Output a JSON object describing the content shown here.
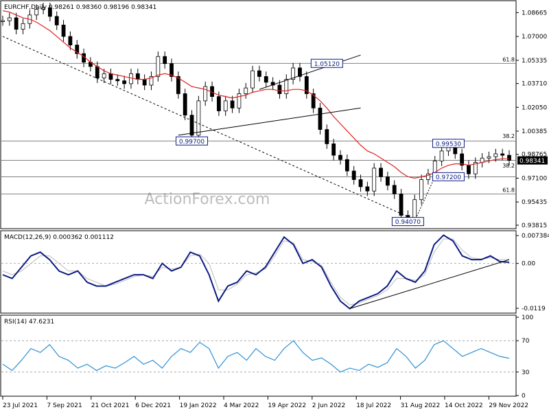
{
  "header": {
    "title": "EURCHF,Daily",
    "ohlc": "0.98261 0.98360 0.98196 0.98341"
  },
  "watermark": "ActionForex.com",
  "colors": {
    "candle": "#000000",
    "sma": "#e02020",
    "macd": "#0a1a80",
    "signal": "#bbbbbb",
    "rsi": "#2c8fd6",
    "levelBox": "#0a1a80"
  },
  "chart_data": [
    {
      "type": "candlestick",
      "title": "EURCHF,Daily",
      "ohlc_last": {
        "open": 0.98261,
        "high": 0.9836,
        "low": 0.98196,
        "close": 0.98341
      },
      "ylim": [
        0.9362,
        1.0945
      ],
      "y_ticks": [
        "1.08665",
        "1.07000",
        "1.05335",
        "1.03710",
        "1.02050",
        "1.00385",
        "0.98765",
        "0.97100",
        "0.95435",
        "0.93815"
      ],
      "y_tick_values": [
        1.08665,
        1.07,
        1.05335,
        1.0371,
        1.0205,
        1.00385,
        0.98765,
        0.971,
        0.95435,
        0.93815
      ],
      "current_price": "0.98341",
      "dates": [
        "23 Jul 2021",
        "7 Sep 2021",
        "21 Oct 2021",
        "6 Dec 2021",
        "19 Jan 2022",
        "4 Mar 2022",
        "19 Apr 2022",
        "2 Jun 2022",
        "18 Jul 2022",
        "31 Aug 2022",
        "14 Oct 2022",
        "29 Nov 2022"
      ],
      "close_series": [
        1.081,
        1.083,
        1.075,
        1.079,
        1.085,
        1.089,
        1.09,
        1.084,
        1.078,
        1.07,
        1.064,
        1.058,
        1.052,
        1.049,
        1.041,
        1.044,
        1.04,
        1.039,
        1.037,
        1.044,
        1.04,
        1.036,
        1.042,
        1.056,
        1.051,
        1.042,
        1.03,
        1.015,
        1.001,
        1.025,
        1.035,
        1.028,
        1.018,
        1.025,
        1.02,
        1.03,
        1.034,
        1.046,
        1.042,
        1.038,
        1.036,
        1.03,
        1.04,
        1.048,
        1.042,
        1.03,
        1.02,
        1.005,
        0.995,
        0.987,
        0.984,
        0.976,
        0.97,
        0.965,
        0.962,
        0.978,
        0.972,
        0.966,
        0.96,
        0.945,
        0.941,
        0.956,
        0.97,
        0.974,
        0.983,
        0.99,
        0.995,
        0.988,
        0.98,
        0.974,
        0.982,
        0.985,
        0.986,
        0.988,
        0.987,
        0.9834
      ],
      "sma_series": [
        1.088,
        1.087,
        1.085,
        1.083,
        1.082,
        1.08,
        1.077,
        1.074,
        1.07,
        1.066,
        1.062,
        1.059,
        1.056,
        1.052,
        1.049,
        1.046,
        1.044,
        1.043,
        1.042,
        1.041,
        1.04,
        1.04,
        1.041,
        1.043,
        1.044,
        1.043,
        1.041,
        1.038,
        1.035,
        1.034,
        1.033,
        1.031,
        1.029,
        1.028,
        1.027,
        1.028,
        1.029,
        1.031,
        1.032,
        1.033,
        1.033,
        1.032,
        1.032,
        1.033,
        1.033,
        1.032,
        1.029,
        1.025,
        1.02,
        1.014,
        1.009,
        1.004,
        0.999,
        0.994,
        0.99,
        0.988,
        0.985,
        0.982,
        0.979,
        0.975,
        0.972,
        0.971,
        0.972,
        0.973,
        0.975,
        0.978,
        0.98,
        0.981,
        0.981,
        0.98,
        0.981,
        0.982,
        0.983,
        0.984,
        0.9845,
        0.9845
      ],
      "level_labels": [
        {
          "text": "1.05120",
          "value": 1.0512,
          "date_index": 48
        },
        {
          "text": "0.99700",
          "value": 0.997,
          "date_index": 28
        },
        {
          "text": "0.99530",
          "value": 0.9953,
          "date_index": 66
        },
        {
          "text": "0.97200",
          "value": 0.972,
          "date_index": 66
        },
        {
          "text": "0.94070",
          "value": 0.9407,
          "date_index": 60
        }
      ],
      "horizontal_lines": [
        1.0512,
        0.997,
        0.9834,
        0.972,
        0.96
      ],
      "fib_labels": [
        {
          "text": "61.8",
          "value": 1.0512
        },
        {
          "text": "38.2",
          "value": 0.9975
        },
        {
          "text": "38.2",
          "value": 0.977
        },
        {
          "text": "61.8",
          "value": 0.96
        }
      ],
      "trendlines": [
        {
          "from": [
            0,
            1.07
          ],
          "to": [
            61,
            0.942
          ],
          "style": "dashed"
        },
        {
          "from": [
            26,
            1.001
          ],
          "to": [
            53,
            1.02
          ],
          "style": "solid"
        },
        {
          "from": [
            38,
            1.033
          ],
          "to": [
            53,
            1.057
          ],
          "style": "solid"
        },
        {
          "from": [
            61,
            0.941
          ],
          "to": [
            64,
            0.972
          ],
          "style": "dotted"
        }
      ]
    },
    {
      "type": "line",
      "title": "MACD(12,26,9) 0.000362 0.001112",
      "ylim": [
        -0.013,
        0.0085
      ],
      "y_ticks": [
        "0.007384",
        "0.00",
        "-0.0119"
      ],
      "y_tick_values": [
        0.007384,
        0.0,
        -0.0119
      ],
      "series": [
        {
          "role": "macd",
          "values": [
            -0.003,
            -0.004,
            -0.001,
            0.002,
            0.003,
            0.001,
            -0.002,
            -0.003,
            -0.002,
            -0.005,
            -0.006,
            -0.006,
            -0.005,
            -0.004,
            -0.003,
            -0.003,
            -0.004,
            0.0,
            -0.002,
            -0.001,
            0.003,
            0.002,
            -0.003,
            -0.01,
            -0.006,
            -0.005,
            -0.002,
            -0.003,
            -0.001,
            0.003,
            0.007,
            0.005,
            0.0,
            0.001,
            -0.001,
            -0.006,
            -0.01,
            -0.012,
            -0.01,
            -0.009,
            -0.008,
            -0.006,
            -0.002,
            -0.004,
            -0.005,
            -0.002,
            0.005,
            0.0075,
            0.006,
            0.002,
            0.001,
            0.001,
            0.002,
            0.0005,
            0.0003
          ]
        },
        {
          "role": "signal",
          "values": [
            -0.002,
            -0.003,
            -0.002,
            0.0,
            0.002,
            0.002,
            0.0,
            -0.002,
            -0.002,
            -0.004,
            -0.005,
            -0.006,
            -0.0055,
            -0.0045,
            -0.0035,
            -0.003,
            -0.0035,
            -0.001,
            -0.0015,
            -0.001,
            0.002,
            0.0025,
            0.0,
            -0.007,
            -0.007,
            -0.0055,
            -0.003,
            -0.0025,
            -0.0015,
            0.002,
            0.006,
            0.0055,
            0.001,
            0.0005,
            -0.0005,
            -0.005,
            -0.009,
            -0.011,
            -0.0105,
            -0.0095,
            -0.0085,
            -0.007,
            -0.004,
            -0.004,
            -0.0045,
            -0.003,
            0.003,
            0.0065,
            0.0065,
            0.0035,
            0.0015,
            0.0012,
            0.0015,
            0.001,
            0.0011
          ]
        }
      ],
      "trendline": {
        "from": [
          37,
          -0.012
        ],
        "to": [
          54,
          0.001
        ]
      }
    },
    {
      "type": "line",
      "title": "RSI(14) 47.6231",
      "ylim": [
        0,
        100
      ],
      "y_ticks": [
        "100",
        "70",
        "30",
        "0"
      ],
      "y_tick_values": [
        100,
        70,
        30,
        0
      ],
      "series": [
        {
          "role": "rsi",
          "values": [
            40,
            32,
            45,
            60,
            55,
            65,
            50,
            45,
            35,
            40,
            32,
            38,
            35,
            42,
            50,
            40,
            45,
            35,
            50,
            60,
            55,
            68,
            60,
            35,
            50,
            55,
            45,
            60,
            50,
            45,
            60,
            70,
            55,
            45,
            48,
            40,
            30,
            35,
            32,
            40,
            36,
            42,
            60,
            50,
            35,
            45,
            65,
            70,
            60,
            50,
            55,
            60,
            55,
            50,
            47.6
          ]
        }
      ]
    }
  ]
}
